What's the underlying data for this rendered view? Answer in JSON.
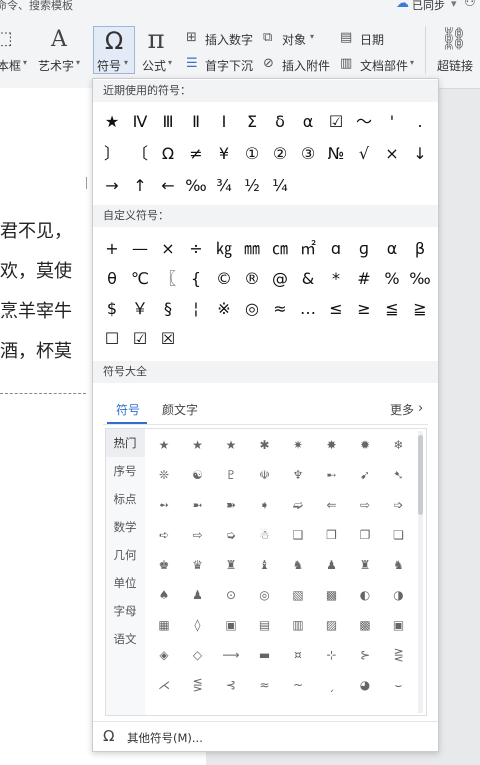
{
  "ribbon": {
    "search_hint": "命令、搜索模板",
    "sync_status": "已同步",
    "btn_textbox": "本框",
    "btn_art": "艺术字",
    "btn_symbol": "符号",
    "btn_formula": "公式",
    "btn_insert_number": "插入数字",
    "btn_object": "对象",
    "btn_date": "日期",
    "btn_dropcap": "首字下沉",
    "btn_attachment": "插入附件",
    "btn_doc_parts": "文档部件",
    "btn_hyperlink": "超链接"
  },
  "document": {
    "lines": [
      "君不见，",
      "欢，莫使",
      "烹羊宰牛",
      "酒，杯莫"
    ]
  },
  "popup": {
    "recent_title": "近期使用的符号：",
    "recent_symbols": [
      [
        "★",
        "Ⅳ",
        "Ⅲ",
        "Ⅱ",
        "Ⅰ",
        "Σ",
        "δ",
        "α",
        "☑",
        "～",
        "'",
        "."
      ],
      [
        "〕",
        "〔",
        "Ω",
        "≠",
        "¥",
        "①",
        "②",
        "③",
        "№",
        "√",
        "×",
        "↓"
      ],
      [
        "→",
        "↑",
        "←",
        "‰",
        "¾",
        "½",
        "¼"
      ]
    ],
    "custom_title": "自定义符号：",
    "custom_symbols": [
      [
        "+",
        "—",
        "×",
        "÷",
        "㎏",
        "㎜",
        "㎝",
        "㎡",
        "ɑ",
        "ɡ",
        "α",
        "β"
      ],
      [
        "θ",
        "℃",
        "〖",
        "{",
        "©",
        "®",
        "@",
        "&",
        "*",
        "#",
        "%",
        "‰"
      ],
      [
        "$",
        "￥",
        "§",
        "¦",
        "※",
        "◎",
        "≈",
        "…",
        "≤",
        "≥",
        "≦",
        "≧"
      ],
      [
        "☐",
        "☑",
        "☒"
      ]
    ],
    "all_title": "符号大全",
    "tabs": [
      "符号",
      "颜文字"
    ],
    "more_label": "更多",
    "categories": [
      "热门",
      "序号",
      "标点",
      "数学",
      "几何",
      "单位",
      "字母",
      "语文"
    ],
    "grid_symbols": [
      [
        "★",
        "★",
        "★",
        "✱",
        "✷",
        "✸",
        "✹",
        "❄"
      ],
      [
        "❊",
        "☯",
        "♇",
        "☫",
        "♆",
        "➸",
        "➹",
        "➷"
      ],
      [
        "➻",
        "➼",
        "➽",
        "➧",
        "➫",
        "⇐",
        "⇨",
        "➩"
      ],
      [
        "➪",
        "⇨",
        "➭",
        "☃",
        "❑",
        "❒",
        "❐",
        "❏"
      ],
      [
        "♚",
        "♛",
        "♜",
        "♝",
        "♞",
        "♟",
        "♜",
        "♞"
      ],
      [
        "♠",
        "♟",
        "⊙",
        "◎",
        "▧",
        "▩",
        "◐",
        "◑"
      ],
      [
        "▦",
        "◊",
        "▣",
        "▤",
        "▥",
        "▨",
        "▩",
        "▣"
      ],
      [
        "◈",
        "◇",
        "⟶",
        "▬",
        "¤",
        "⊹",
        "⊱",
        "⋛"
      ],
      [
        "⋌",
        "⋚",
        "⊰",
        "≈",
        "~",
        "ˏ",
        "◕",
        "⌣"
      ]
    ],
    "footer_label": "其他符号(M)..."
  }
}
